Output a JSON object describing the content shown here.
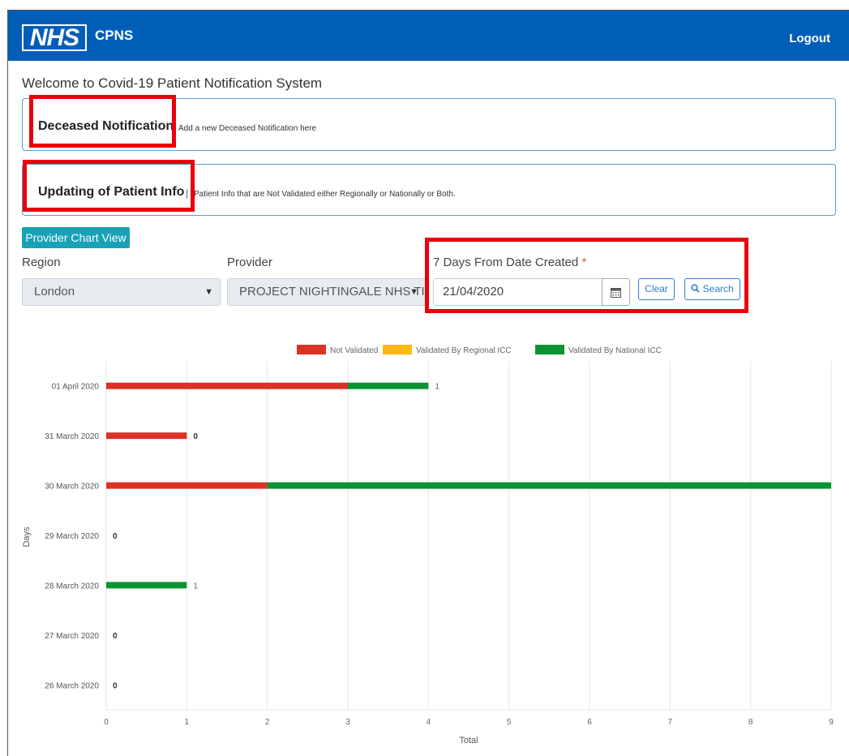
{
  "header": {
    "logo_text": "NHS",
    "app_name": "CPNS",
    "logout_label": "Logout",
    "background": "#005eb8"
  },
  "welcome_text": "Welcome to Covid-19 Patient Notification System",
  "cards": [
    {
      "title": "Deceased Notification",
      "separator": "",
      "description": "Add a new Deceased Notification here"
    },
    {
      "title": "Updating of Patient Info",
      "separator": "|",
      "description": "Patient Info that are Not Validated either Regionally or Nationally or Both."
    }
  ],
  "chart_view_button": "Provider Chart View",
  "filters": {
    "region_label": "Region",
    "region_value": "London",
    "provider_label": "Provider",
    "provider_value": "PROJECT NIGHTINGALE NHS TI",
    "date_label": "7 Days From Date Created",
    "required_mark": "*",
    "date_value": "21/04/2020",
    "calendar_icon": "calendar-icon",
    "clear_label": "Clear",
    "search_label": "Search",
    "search_icon": "search-icon"
  },
  "colors": {
    "not_validated": "#dc3226",
    "regional": "#ffb714",
    "national": "#0b9433",
    "button_teal": "#17a2b8",
    "highlight": "#e8000b"
  },
  "chart_data": {
    "type": "bar",
    "orientation": "horizontal",
    "stacked": true,
    "categories": [
      "01 April 2020",
      "31 March 2020",
      "30 March 2020",
      "29 March 2020",
      "28 March 2020",
      "27 March 2020",
      "26 March 2020"
    ],
    "series": [
      {
        "name": "Not Validated",
        "values": [
          3,
          1,
          2,
          0,
          0,
          0,
          0
        ]
      },
      {
        "name": "Validated By Regional ICC",
        "values": [
          0,
          0,
          0,
          0,
          0,
          0,
          0
        ]
      },
      {
        "name": "Validated By National ICC",
        "values": [
          1,
          0,
          7,
          0,
          1,
          0,
          0
        ]
      }
    ],
    "data_labels": [
      "1",
      "0",
      "",
      "0",
      "1",
      "0",
      "0"
    ],
    "xlabel": "Total",
    "ylabel": "Days",
    "xlim": [
      0,
      9
    ],
    "xticks": [
      0,
      1,
      2,
      3,
      4,
      5,
      6,
      7,
      8,
      9
    ],
    "grid": true,
    "legend": "top"
  }
}
